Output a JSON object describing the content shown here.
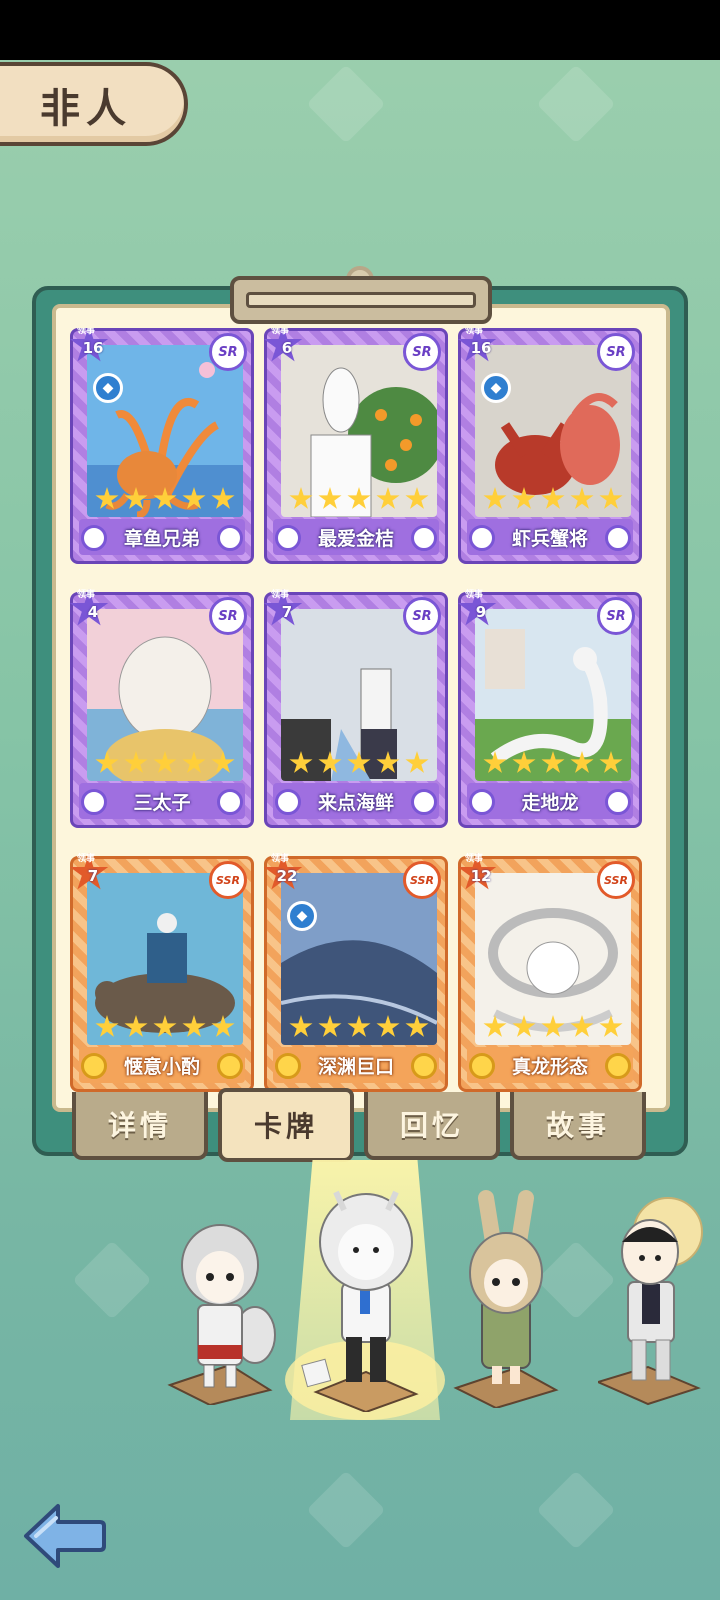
{
  "header": {
    "title": "非人"
  },
  "cards": [
    {
      "level_tag": "领事",
      "level": "16",
      "rarity": "SR",
      "name": "章鱼兄弟",
      "stars": 5,
      "fish_badge": true
    },
    {
      "level_tag": "领事",
      "level": "6",
      "rarity": "SR",
      "name": "最爱金桔",
      "stars": 5,
      "fish_badge": false
    },
    {
      "level_tag": "领事",
      "level": "16",
      "rarity": "SR",
      "name": "虾兵蟹将",
      "stars": 5,
      "fish_badge": true
    },
    {
      "level_tag": "领事",
      "level": "4",
      "rarity": "SR",
      "name": "三太子",
      "stars": 5,
      "fish_badge": false
    },
    {
      "level_tag": "领事",
      "level": "7",
      "rarity": "SR",
      "name": "来点海鲜",
      "stars": 5,
      "fish_badge": false
    },
    {
      "level_tag": "领事",
      "level": "9",
      "rarity": "SR",
      "name": "走地龙",
      "stars": 5,
      "fish_badge": false
    },
    {
      "level_tag": "领事",
      "level": "7",
      "rarity": "SSR",
      "name": "惬意小酌",
      "stars": 5,
      "fish_badge": false
    },
    {
      "level_tag": "领事",
      "level": "22",
      "rarity": "SSR",
      "name": "深渊巨口",
      "stars": 5,
      "fish_badge": true
    },
    {
      "level_tag": "领事",
      "level": "12",
      "rarity": "SSR",
      "name": "真龙形态",
      "stars": 5,
      "fish_badge": false
    }
  ],
  "tabs": [
    {
      "label": "详情",
      "active": false
    },
    {
      "label": "卡牌",
      "active": true
    },
    {
      "label": "回忆",
      "active": false
    },
    {
      "label": "故事",
      "active": false
    }
  ],
  "colors": {
    "sr_frame": "#b07fe2",
    "ssr_frame": "#f2a35c",
    "star": "#ffcf3a",
    "background": "#86c4a6"
  },
  "icons": {
    "back": "back-arrow-icon",
    "fish": "fish-icon"
  }
}
